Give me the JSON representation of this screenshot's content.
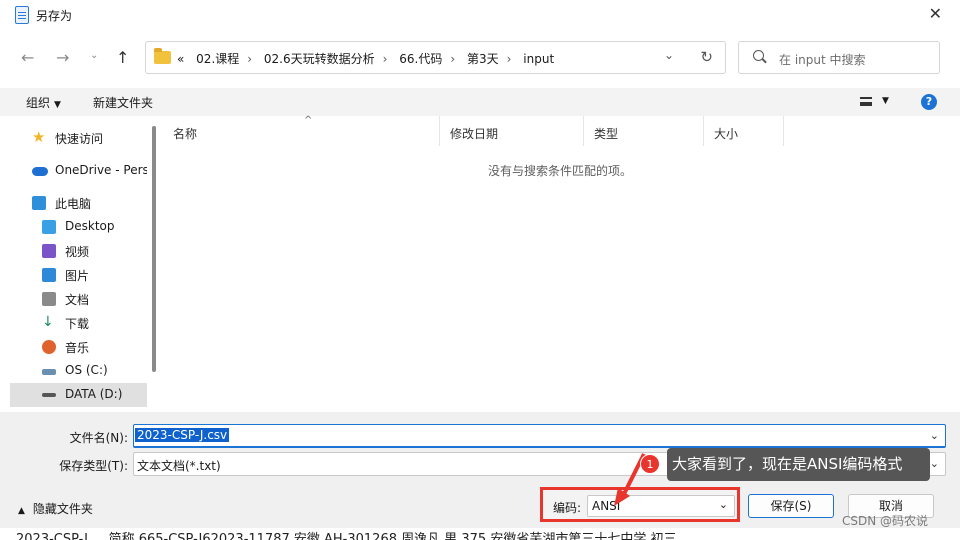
{
  "window": {
    "title": "另存为"
  },
  "address": {
    "crumbs": [
      "«",
      "02.课程",
      "02.6天玩转数据分析",
      "66.代码",
      "第3天",
      "input"
    ]
  },
  "search": {
    "placeholder": "在 input 中搜索"
  },
  "toolbar": {
    "organize": "组织",
    "new_folder": "新建文件夹",
    "help": "?"
  },
  "sidebar": {
    "items": [
      {
        "label": "快速访问",
        "icon": "star-icon",
        "color": "#f1b626"
      },
      {
        "label": "OneDrive - Pers",
        "icon": "cloud-icon",
        "color": "#1d6fd1"
      },
      {
        "label": "此电脑",
        "icon": "computer-icon",
        "color": "#2f8fd8"
      },
      {
        "label": "Desktop",
        "icon": "desktop-icon",
        "color": "#3aa0e6"
      },
      {
        "label": "视频",
        "icon": "video-icon",
        "color": "#7b55c8"
      },
      {
        "label": "图片",
        "icon": "picture-icon",
        "color": "#2e8ad8"
      },
      {
        "label": "文档",
        "icon": "document-icon",
        "color": "#8a8a8a"
      },
      {
        "label": "下载",
        "icon": "download-icon",
        "color": "#1b8b5c"
      },
      {
        "label": "音乐",
        "icon": "music-icon",
        "color": "#e0622d"
      },
      {
        "label": "OS (C:)",
        "icon": "drive-c-icon",
        "color": "#6b8fb0"
      },
      {
        "label": "DATA (D:)",
        "icon": "drive-d-icon",
        "color": "#555555"
      }
    ],
    "selected_index": 10
  },
  "columns": [
    "名称",
    "修改日期",
    "类型",
    "大小"
  ],
  "empty_message": "没有与搜索条件匹配的项。",
  "form": {
    "filename_label": "文件名(N):",
    "filename_value": "2023-CSP-J.csv",
    "filetype_label": "保存类型(T):",
    "filetype_value": "文本文档(*.txt)",
    "encoding_label": "编码:",
    "encoding_value": "ANSI"
  },
  "buttons": {
    "hide_folders": "隐藏文件夹",
    "save": "保存(S)",
    "cancel": "取消"
  },
  "annotation": {
    "badge": "1",
    "text": "大家看到了，现在是ANSI编码格式"
  },
  "background_text": "2023-CSP-J ... 简称 665-CSP-J62023-11787 安徽 AH-301268 周逸凡 男 375 安徽省芜湖市第三十七中学 初三",
  "watermark": "CSDN @码农说",
  "colors": {
    "accent": "#1c73d6",
    "highlight_frame": "#e8352d",
    "callout_bg": "#565656"
  }
}
